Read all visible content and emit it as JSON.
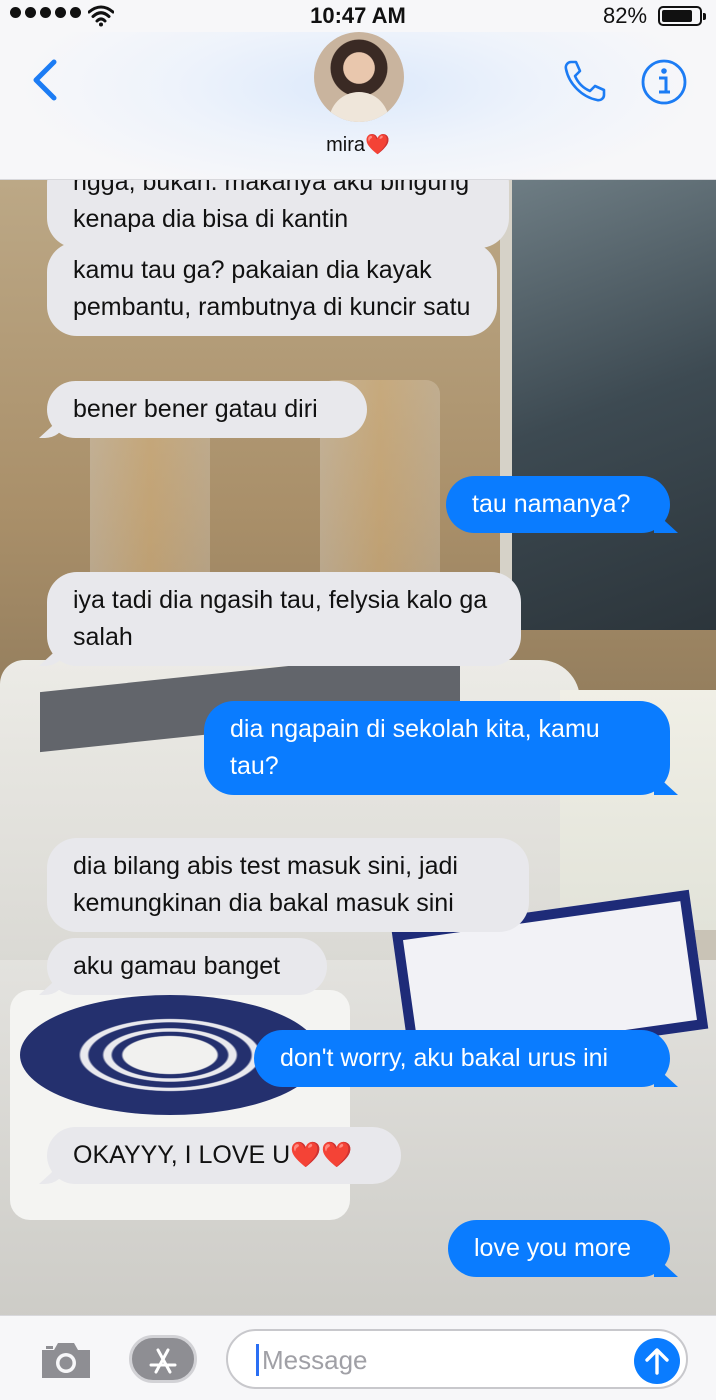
{
  "status_bar": {
    "time": "10:47 AM",
    "battery_percent": "82%",
    "battery_level": 0.82,
    "signal_bars": 5
  },
  "header": {
    "contact_name": "mira",
    "contact_emoji": "❤️",
    "back_icon": "chevron-left-icon",
    "call_icon": "phone-icon",
    "info_icon": "info-icon"
  },
  "messages": [
    {
      "sender": "them",
      "text": "ngga, bukan. makanya aku bingung kenapa dia bisa di kantin"
    },
    {
      "sender": "them",
      "text": "kamu tau ga? pakaian dia kayak pembantu, rambutnya di kuncir satu"
    },
    {
      "sender": "them",
      "text": "bener bener gatau diri"
    },
    {
      "sender": "me",
      "text": "tau namanya?"
    },
    {
      "sender": "them",
      "text": "iya tadi dia ngasih tau, felysia kalo ga salah"
    },
    {
      "sender": "me",
      "text": "dia ngapain di sekolah kita, kamu tau?"
    },
    {
      "sender": "them",
      "text": "dia bilang abis test masuk sini, jadi kemungkinan dia bakal masuk sini"
    },
    {
      "sender": "them",
      "text": "aku gamau banget"
    },
    {
      "sender": "me",
      "text": "don't worry, aku bakal urus ini"
    },
    {
      "sender": "them",
      "text": "OKAYYY, I LOVE U",
      "emoji": "❤️❤️"
    },
    {
      "sender": "me",
      "text": "love you more"
    }
  ],
  "input_bar": {
    "placeholder": "Message",
    "camera_icon": "camera-icon",
    "apps_icon": "app-store-icon",
    "send_icon": "send-arrow-icon"
  },
  "colors": {
    "sent_bubble": "#0a7cff",
    "received_bubble": "#e8e8ec",
    "accent": "#1c7cf4"
  }
}
